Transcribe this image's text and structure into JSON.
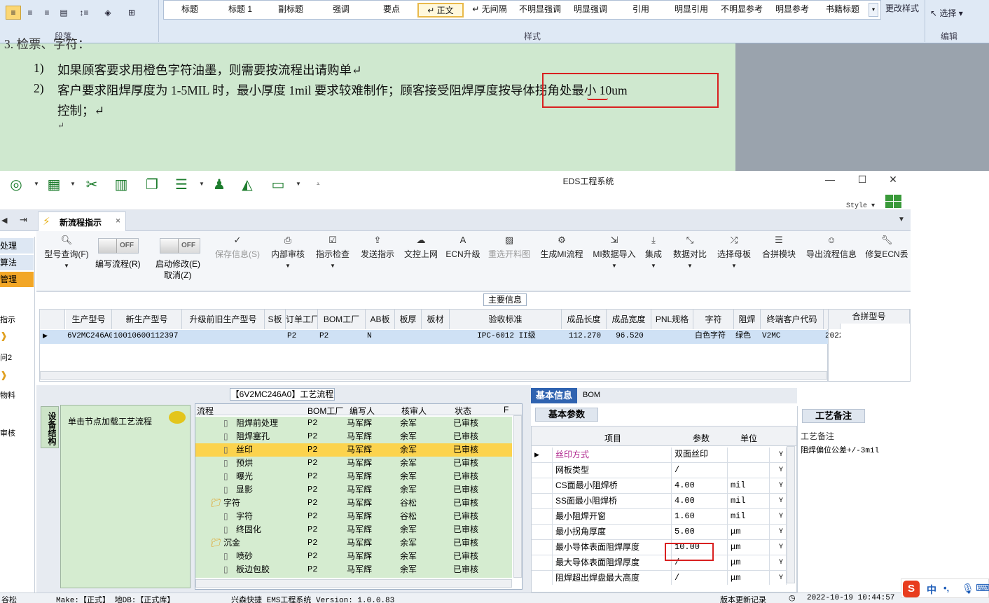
{
  "ribbon": {
    "paragraph_group_label": "段落",
    "styles_group_label": "样式",
    "editing_group_label": "编辑",
    "styles": [
      "标题",
      "标题 1",
      "副标题",
      "强调",
      "要点",
      "↵ 正文",
      "↵ 无间隔",
      "不明显强调",
      "明显强调",
      "引用",
      "明显引用",
      "不明显参考",
      "明显参考",
      "书籍标题"
    ],
    "change_styles_label": "更改样式",
    "select_label": "选择"
  },
  "document": {
    "line0": "3.  检票、字符：",
    "item1_num": "1)",
    "item1_text": "如果顾客要求用橙色字符油墨，则需要按流程出请购单↵",
    "item2_num": "2)",
    "item2_text": "客户要求阻焊厚度为 1-5MIL 时，最小厚度 1mil 要求较难制作；顾客接受阻焊厚度按导体拐角处最小 10um",
    "item2_cont": "控制；↵",
    "empty_mark": "↵"
  },
  "window": {
    "title": "EDS工程系统",
    "style_label": "Style",
    "minimize": "—",
    "maximize": "☐",
    "close": "✕"
  },
  "nav_left": {
    "items": [
      "处理",
      "算法",
      "管理",
      "指示",
      "问2",
      "物料",
      "审核"
    ]
  },
  "tab": {
    "label": "新流程指示",
    "close": "×"
  },
  "toolbar": {
    "buttons": [
      {
        "label": "型号查询(F)",
        "icon": "search-icon"
      },
      {
        "label": "保存信息(S)",
        "icon": "check-icon"
      },
      {
        "label": "内部审核",
        "icon": "print-icon"
      },
      {
        "label": "指示检查",
        "icon": "checkbox-icon"
      },
      {
        "label": "发送指示",
        "icon": "upload-icon"
      },
      {
        "label": "文控上网",
        "icon": "cloud-upload-icon"
      },
      {
        "label": "ECN升级",
        "icon": "letter-a-icon"
      },
      {
        "label": "重选开料图",
        "icon": "image-icon"
      },
      {
        "label": "生成MI流程",
        "icon": "gears-icon"
      },
      {
        "label": "MI数据导入",
        "icon": "import-icon"
      },
      {
        "label": "集成",
        "icon": "download-icon"
      },
      {
        "label": "数据对比",
        "icon": "compress-icon"
      },
      {
        "label": "选择母板",
        "icon": "shuffle-icon"
      },
      {
        "label": "合拼模块",
        "icon": "list-icon"
      },
      {
        "label": "导出流程信息",
        "icon": "smile-icon"
      },
      {
        "label": "修复ECN丢",
        "icon": "wrench-icon"
      }
    ],
    "toggle_edit_label": "编写流程(R)",
    "toggle_start_label": "启动修改(E)",
    "toggle_start_sub": "取消(Z)",
    "toggle_state": "OFF"
  },
  "main_info": {
    "title": "主要信息",
    "columns": [
      "生产型号",
      "新生产型号",
      "升级前旧生产型号",
      "S板",
      "订单工厂",
      "BOM工厂",
      "AB板",
      "板厚",
      "板材",
      "验收标准",
      "成品长度",
      "成品宽度",
      "PNL规格",
      "字符",
      "阻焊",
      "终端客户代码",
      "型"
    ],
    "row": [
      "6V2MC246A0",
      "10010600112397",
      "",
      "",
      "P2",
      "P2",
      "N",
      "",
      "",
      "IPC-6012 II级",
      "112.270",
      "96.520",
      "",
      "白色字符",
      "绿色",
      "V2MC",
      "2022"
    ],
    "merge_col": "合拼型号"
  },
  "process": {
    "title": "【6V2MC246A0】工艺流程",
    "side_tab": "设备结构",
    "hint": "单击节点加载工艺流程",
    "columns": [
      "流程",
      "BOM工厂",
      "编写人",
      "核审人",
      "状态",
      "F"
    ],
    "rows": [
      {
        "name": "阻焊前处理",
        "bom": "P2",
        "writer": "马军辉",
        "reviewer": "余军",
        "status": "已审核",
        "level": 2
      },
      {
        "name": "阻焊塞孔",
        "bom": "P2",
        "writer": "马军辉",
        "reviewer": "余军",
        "status": "已审核",
        "level": 2
      },
      {
        "name": "丝印",
        "bom": "P2",
        "writer": "马军辉",
        "reviewer": "余军",
        "status": "已审核",
        "level": 2,
        "selected": true
      },
      {
        "name": "预烘",
        "bom": "P2",
        "writer": "马军辉",
        "reviewer": "余军",
        "status": "已审核",
        "level": 2
      },
      {
        "name": "曝光",
        "bom": "P2",
        "writer": "马军辉",
        "reviewer": "余军",
        "status": "已审核",
        "level": 2
      },
      {
        "name": "显影",
        "bom": "P2",
        "writer": "马军辉",
        "reviewer": "余军",
        "status": "已审核",
        "level": 2
      },
      {
        "name": "字符",
        "bom": "P2",
        "writer": "马军辉",
        "reviewer": "谷松",
        "status": "已审核",
        "level": 1
      },
      {
        "name": "字符",
        "bom": "P2",
        "writer": "马军辉",
        "reviewer": "谷松",
        "status": "已审核",
        "level": 2
      },
      {
        "name": "终固化",
        "bom": "P2",
        "writer": "马军辉",
        "reviewer": "余军",
        "status": "已审核",
        "level": 2
      },
      {
        "name": "沉金",
        "bom": "P2",
        "writer": "马军辉",
        "reviewer": "余军",
        "status": "已审核",
        "level": 1
      },
      {
        "name": "喷砂",
        "bom": "P2",
        "writer": "马军辉",
        "reviewer": "余军",
        "status": "已审核",
        "level": 2
      },
      {
        "name": "板边包胶",
        "bom": "P2",
        "writer": "马军辉",
        "reviewer": "余军",
        "status": "已审核",
        "level": 2
      }
    ]
  },
  "params": {
    "tabs": [
      "基本信息",
      "BOM"
    ],
    "subtitle": "基本参数",
    "columns": [
      "项目",
      "参数",
      "单位"
    ],
    "rows": [
      {
        "item": "丝印方式",
        "value": "双面丝印",
        "unit": "",
        "flag": "Y",
        "highlight": true
      },
      {
        "item": "网板类型",
        "value": "/",
        "unit": "",
        "flag": "Y"
      },
      {
        "item": "CS面最小阻焊桥",
        "value": "4.00",
        "unit": "mil",
        "flag": "Y"
      },
      {
        "item": "SS面最小阻焊桥",
        "value": "4.00",
        "unit": "mil",
        "flag": "Y"
      },
      {
        "item": "最小阻焊开窗",
        "value": "1.60",
        "unit": "mil",
        "flag": "Y"
      },
      {
        "item": "最小拐角厚度",
        "value": "5.00",
        "unit": "μm",
        "flag": "Y"
      },
      {
        "item": "最小导体表面阻焊厚度",
        "value": "10.00",
        "unit": "μm",
        "flag": "Y"
      },
      {
        "item": "最大导体表面阻焊厚度",
        "value": "/",
        "unit": "μm",
        "flag": "Y"
      },
      {
        "item": "阻焊超出焊盘最大高度",
        "value": "/",
        "unit": "μm",
        "flag": "Y"
      }
    ]
  },
  "notes": {
    "tab": "工艺备注",
    "header": "工艺备注",
    "text": "阻焊偏位公差+/-3mil"
  },
  "statusbar": {
    "left": "谷松",
    "mid": "Make:【正式】 地DB:【正式库】",
    "app": "兴森快捷 EMS工程系统 Version: 1.0.0.83",
    "update": "版本更新记录",
    "time": "2022-10-19 10:44:57"
  },
  "ime": {
    "lang": "中",
    "punct": "•,"
  },
  "colors": {
    "ribbon_bg": "#dfe9f5",
    "doc_bg": "#cfe8cf",
    "grid_green": "#d5ecd0",
    "selected_row": "#fcd34d",
    "annotation_red": "#d92020",
    "accent_blue": "#2f63b0"
  }
}
